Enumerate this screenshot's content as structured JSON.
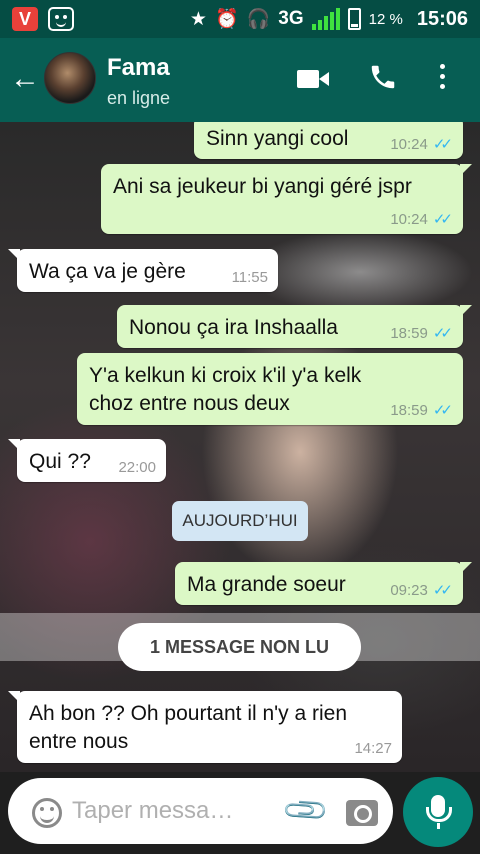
{
  "statusbar": {
    "vivo_app_label": "V",
    "network": "3G",
    "battery": "12 %",
    "time": "15:06"
  },
  "header": {
    "back_icon": "arrow-left-icon",
    "contact_name": "Fama",
    "contact_status": "en ligne"
  },
  "messages": [
    {
      "direction": "out",
      "text": "Sinn yangi cool",
      "time": "10:24",
      "read": true
    },
    {
      "direction": "out",
      "text": "Ani sa jeukeur bi yangi géré jspr",
      "time": "10:24",
      "read": true
    },
    {
      "direction": "in",
      "text": "Wa ça va je gère",
      "time": "11:55"
    },
    {
      "direction": "out",
      "text": "Nonou ça ira Inshaalla",
      "time": "18:59",
      "read": true
    },
    {
      "direction": "out",
      "text": "Y'a kelkun ki croix k'il y'a kelk\nchoz entre nous deux",
      "time": "18:59",
      "read": true
    },
    {
      "direction": "in",
      "text": "Qui ??",
      "time": "22:00"
    },
    {
      "direction": "out",
      "text": "Ma grande soeur",
      "time": "09:23",
      "read": true
    },
    {
      "direction": "in",
      "text": "Ah bon ?? Oh pourtant il n'y a rien\nentre nous",
      "time": "14:27"
    }
  ],
  "date_divider": "AUJOURD’HUI",
  "unread_label": "1 MESSAGE NON LU",
  "input": {
    "placeholder": "Taper messa…",
    "value": ""
  },
  "colors": {
    "header": "#075e54",
    "statusbar": "#054d44",
    "outgoing_bubble": "#dcf8c6",
    "incoming_bubble": "#ffffff",
    "read_ticks": "#34b7f1",
    "mic_button": "#05897b"
  }
}
